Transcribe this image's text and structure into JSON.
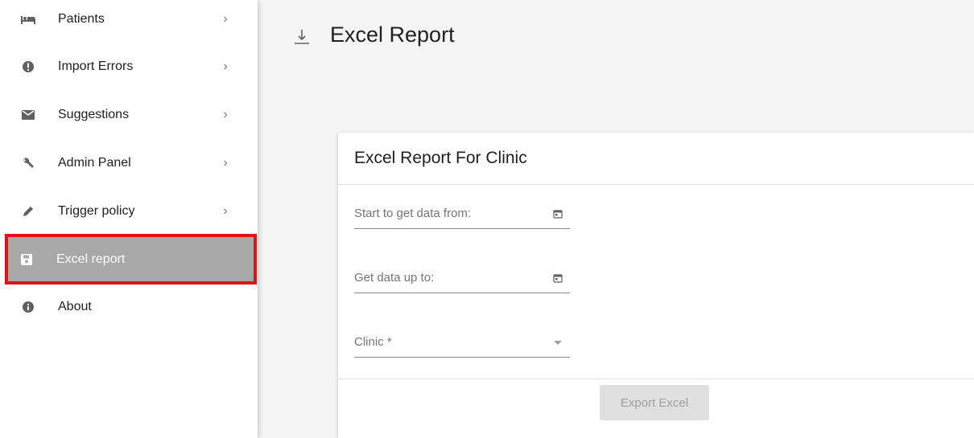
{
  "sidebar": {
    "items": [
      {
        "label": "Patients",
        "icon": "bed-icon",
        "chevron": "›"
      },
      {
        "label": "Import Errors",
        "icon": "alert-circle-icon",
        "chevron": "›"
      },
      {
        "label": "Suggestions",
        "icon": "mail-icon",
        "chevron": "›"
      },
      {
        "label": "Admin Panel",
        "icon": "wrench-icon",
        "chevron": "›"
      },
      {
        "label": "Trigger policy",
        "icon": "pencil-icon",
        "chevron": "›"
      },
      {
        "label": "Excel report",
        "icon": "save-icon",
        "active": true
      },
      {
        "label": "About",
        "icon": "info-icon"
      }
    ],
    "active_highlight_color": "#e1111a",
    "active_background": "#a8a8a8"
  },
  "header": {
    "title": "Excel Report",
    "icon": "download-icon"
  },
  "card": {
    "title": "Excel Report For Clinic",
    "fields": {
      "start": {
        "placeholder": "Start to get data from:",
        "value": "",
        "icon": "calendar-icon"
      },
      "end": {
        "placeholder": "Get data up to:",
        "value": "",
        "icon": "calendar-icon"
      },
      "clinic": {
        "placeholder": "Clinic *",
        "value": "",
        "icon": "dropdown-arrow-icon"
      }
    },
    "export_label": "Export Excel",
    "export_disabled": true
  }
}
